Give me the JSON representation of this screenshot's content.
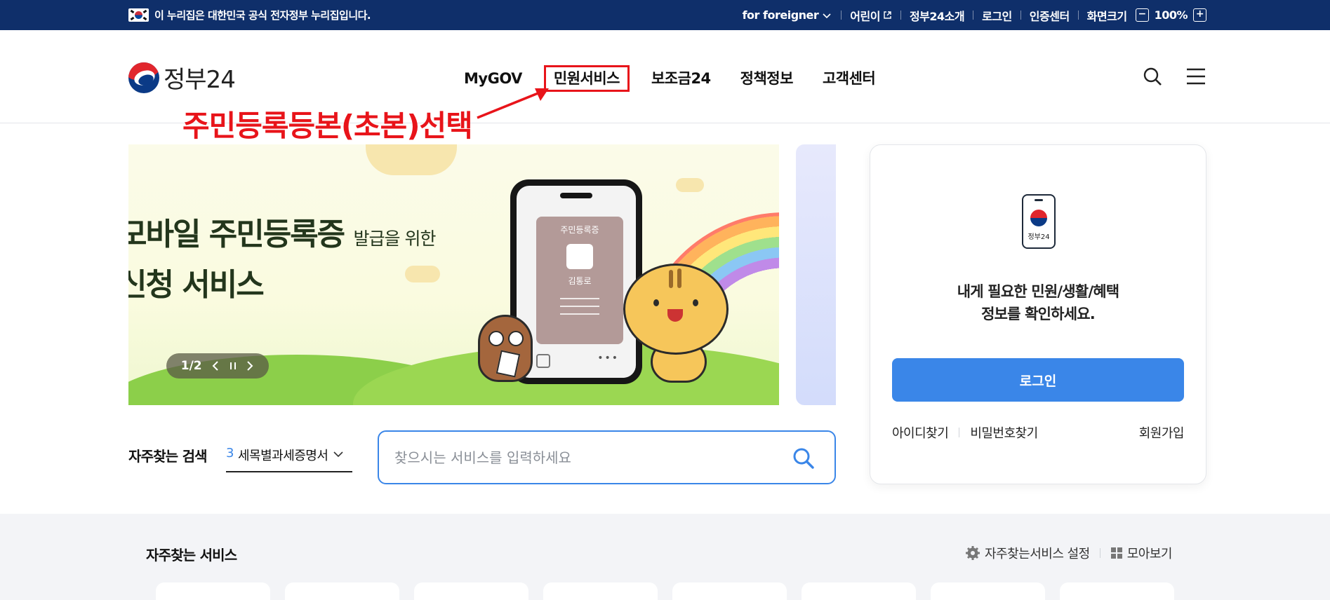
{
  "gov_banner": {
    "notice": "이 누리집은 대한민국 공식 전자정부 누리집입니다.",
    "links": {
      "foreigner": "for foreigner",
      "kids": "어린이",
      "about": "정부24소개",
      "login": "로그인",
      "cert": "인증센터",
      "screen_size": "화면크기",
      "zoom_minus": "−",
      "zoom_value": "100%",
      "zoom_plus": "+"
    }
  },
  "header": {
    "logo_text": "정부24",
    "nav": [
      "MyGOV",
      "민원서비스",
      "보조금24",
      "정책정보",
      "고객센터"
    ],
    "highlighted_nav_index": 1,
    "highlight_color": "#e8141a"
  },
  "annotation": {
    "text": "주민등록등본(초본)선택"
  },
  "banner": {
    "headline_line1": "모바일 주민등록증",
    "headline_line1_small": "발급을 위한",
    "headline_line2": "신청 서비스",
    "card_title": "주민등록증",
    "card_name": "김통로",
    "pager": "1/2"
  },
  "login_panel": {
    "device_label": "정부24",
    "message_line1": "내게 필요한 민원/생활/혜택",
    "message_line2": "정보를 확인하세요.",
    "login_button": "로그인",
    "find_id": "아이디찾기",
    "find_pw": "비밀번호찾기",
    "join": "회원가입",
    "accent": "#3a86e8"
  },
  "search": {
    "fav_label": "자주찾는 검색",
    "fav_rank": "3",
    "fav_term": "세목별과세증명서",
    "placeholder": "찾으시는 서비스를 입력하세요"
  },
  "services": {
    "title": "자주찾는 서비스",
    "settings": "자주찾는서비스 설정",
    "view_all": "모아보기"
  }
}
